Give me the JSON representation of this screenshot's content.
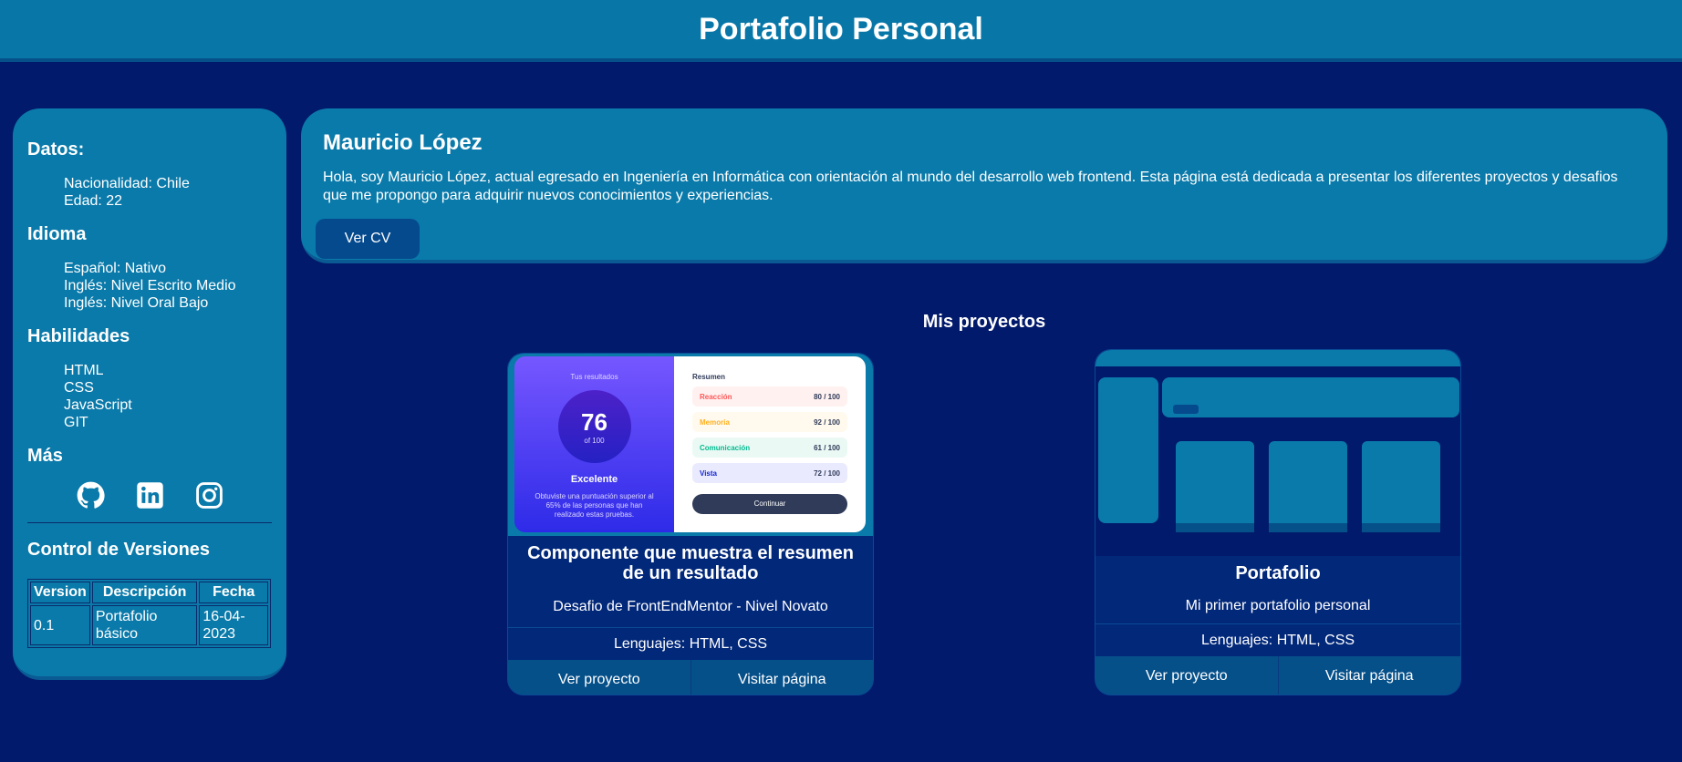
{
  "header": {
    "title": "Portafolio Personal"
  },
  "sidebar": {
    "datos_title": "Datos:",
    "datos": [
      "Nacionalidad: Chile",
      "Edad: 22"
    ],
    "idioma_title": "Idioma",
    "idiomas": [
      "Español: Nativo",
      "Inglés: Nivel Escrito Medio",
      "Inglés: Nivel Oral Bajo"
    ],
    "habilidades_title": "Habilidades",
    "habilidades": [
      "HTML",
      "CSS",
      "JavaScript",
      "GIT"
    ],
    "mas_title": "Más",
    "social_icons": [
      "github-icon",
      "linkedin-icon",
      "instagram-icon"
    ],
    "versiones_title": "Control de Versiones",
    "versiones_headers": [
      "Version",
      "Descripción",
      "Fecha"
    ],
    "versiones_rows": [
      [
        "0.1",
        "Portafolio básico",
        "16-04-2023"
      ]
    ]
  },
  "hero": {
    "name": "Mauricio López",
    "bio": "Hola, soy Mauricio López, actual egresado en Ingeniería en Informática con orientación al mundo del desarrollo web frontend. Esta página está dedicada a presentar los diferentes proyectos y desafios que me propongo para adquirir nuevos conocimientos y experiencias.",
    "cv_button": "Ver CV"
  },
  "projects": {
    "title": "Mis proyectos",
    "items": [
      {
        "title": "Componente que muestra el resumen de un resultado",
        "description": "Desafio de FrontEndMentor - Nivel Novato",
        "languages": "Lenguajes: HTML, CSS",
        "btn_project": "Ver proyecto",
        "btn_page": "Visitar página",
        "preview": {
          "left_label": "Tus resultados",
          "score": "76",
          "of": "of 100",
          "grade": "Excelente",
          "text": "Obtuviste una puntuación superior al 65% de las personas que han realizado estas pruebas.",
          "summary": "Resumen",
          "rows": [
            {
              "label": "Reacción",
              "value": "80 / 100",
              "color": "#fff1f0",
              "text": "#ff5757"
            },
            {
              "label": "Memoria",
              "value": "92 / 100",
              "color": "#fffaed",
              "text": "#ffb020"
            },
            {
              "label": "Comunicación",
              "value": "61 / 100",
              "color": "#ebf9f5",
              "text": "#00bb8f"
            },
            {
              "label": "Vista",
              "value": "72 / 100",
              "color": "#eaeafe",
              "text": "#1125d4"
            }
          ],
          "button": "Continuar"
        }
      },
      {
        "title": "Portafolio",
        "description": "Mi primer portafolio personal",
        "languages": "Lenguajes: HTML, CSS",
        "btn_project": "Ver proyecto",
        "btn_page": "Visitar página"
      }
    ]
  },
  "colors": {
    "background": "#021a6b",
    "panel": "#0a7aaa",
    "button": "#064a8e"
  }
}
